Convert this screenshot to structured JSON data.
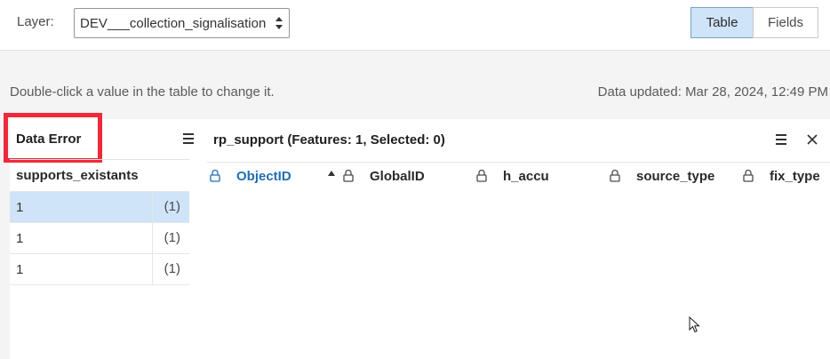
{
  "toolbar": {
    "layer_label": "Layer:",
    "layer_value": "DEV___collection_signalisation",
    "view_table": "Table",
    "view_fields": "Fields"
  },
  "info": {
    "hint": "Double-click a value in the table to change it.",
    "updated": "Data updated: Mar 28, 2024, 12:49 PM"
  },
  "left_panel": {
    "title": "Data Error",
    "column": "supports_existants",
    "rows": [
      {
        "value": "1",
        "count": "(1)",
        "selected": true
      },
      {
        "value": "1",
        "count": "(1)",
        "selected": false
      },
      {
        "value": "1",
        "count": "(1)",
        "selected": false
      }
    ]
  },
  "right_panel": {
    "title": "rp_support (Features: 1, Selected: 0)",
    "columns": [
      "ObjectID",
      "GlobalID",
      "h_accu",
      "source_type",
      "fix_type"
    ]
  },
  "colors": {
    "accent": "#1f6fb2",
    "selected_bg": "#cfe4f8",
    "highlight_box": "#ee2a3a"
  },
  "icons": [
    "chevron-updown-icon",
    "menu-icon",
    "close-icon",
    "lock-icon",
    "sort-ascending-icon",
    "mouse-cursor-icon"
  ]
}
